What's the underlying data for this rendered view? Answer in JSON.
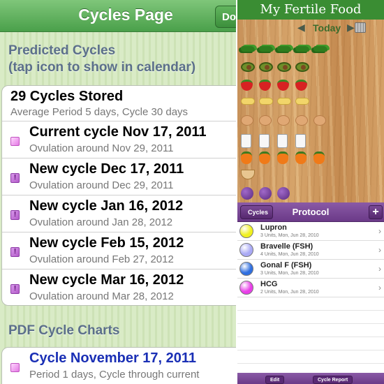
{
  "cycles_page": {
    "title": "Cycles Page",
    "done_label": "Do",
    "predicted_header_line1": "Predicted Cycles",
    "predicted_header_line2": "(tap icon to show in calendar)",
    "stored": {
      "title": "29 Cycles Stored",
      "subtitle": "Average Period 5 days, Cycle 30 days"
    },
    "cycles": [
      {
        "title": "Current cycle Nov 17, 2011",
        "subtitle": "Ovulation around Nov 29, 2011",
        "icon": "calendar-pink-icon"
      },
      {
        "title": "New cycle Dec 17, 2011",
        "subtitle": "Ovulation around Dec 29, 2011",
        "icon": "calendar-alert-icon"
      },
      {
        "title": "New cycle Jan 16, 2012",
        "subtitle": "Ovulation around Jan 28, 2012",
        "icon": "calendar-alert-icon"
      },
      {
        "title": "New cycle Feb 15, 2012",
        "subtitle": "Ovulation around Feb 27, 2012",
        "icon": "calendar-alert-icon"
      },
      {
        "title": "New cycle Mar 16, 2012",
        "subtitle": "Ovulation around Mar 28, 2012",
        "icon": "calendar-alert-icon"
      }
    ],
    "pdf_header": "PDF Cycle Charts",
    "pdf_item": {
      "title": "Cycle November 17, 2011",
      "subtitle": "Period 1 days, Cycle through current"
    }
  },
  "fertile_food": {
    "title": "My Fertile Food",
    "prev_arrow": "◀",
    "date_label": "Today",
    "next_arrow": "▶",
    "food_rows": [
      {
        "type": "greens",
        "count": 5
      },
      {
        "type": "avocado",
        "count": 4
      },
      {
        "type": "straw",
        "count": 4
      },
      {
        "type": "banana",
        "count": 4
      },
      {
        "type": "egg",
        "count": 5
      },
      {
        "type": "milk",
        "count": 4
      },
      {
        "type": "pepper",
        "count": 5
      },
      {
        "type": "bowl",
        "count": 1
      },
      {
        "type": "plum",
        "count": 3
      }
    ]
  },
  "protocol": {
    "back_label": "Cycles",
    "title": "Protocol",
    "add_label": "+",
    "items": [
      {
        "name": "Lupron",
        "detail": "3 Units, Mon, Jun 28, 2010",
        "color": "#f0f01e"
      },
      {
        "name": "Bravelle (FSH)",
        "detail": "4 Units, Mon, Jun 28, 2010",
        "color": "#a9a9f5"
      },
      {
        "name": "Gonal F (FSH)",
        "detail": "3 Units, Mon, Jun 28, 2010",
        "color": "#2f6fe0"
      },
      {
        "name": "HCG",
        "detail": "2 Units, Mon, Jun 28, 2010",
        "color": "#e83ee8"
      }
    ],
    "chevron": "›",
    "edit_label": "Edit",
    "report_label": "Cycle Report"
  }
}
